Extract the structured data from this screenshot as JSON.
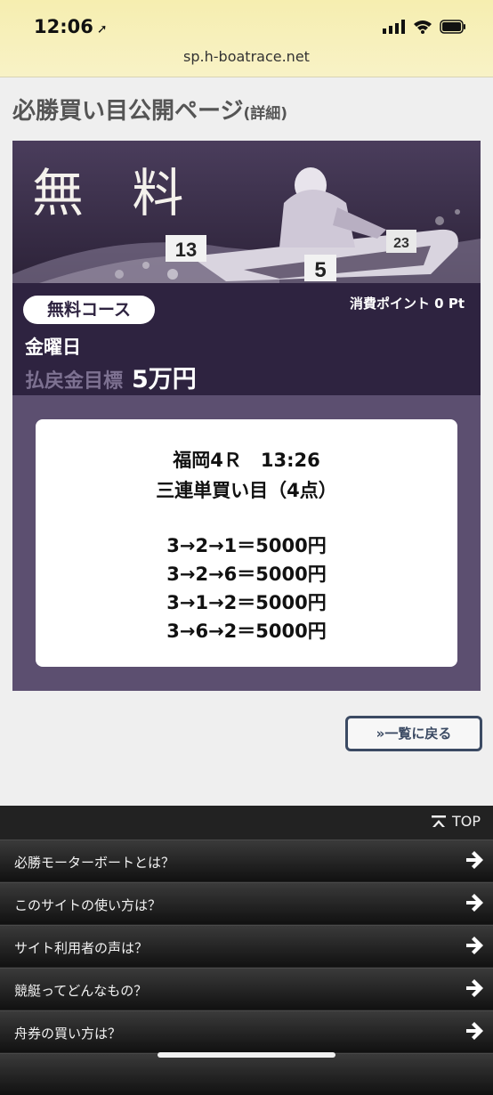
{
  "status_bar": {
    "time": "12:06"
  },
  "browser": {
    "url": "sp.h-boatrace.net"
  },
  "page": {
    "title": "必勝買い目公開ページ",
    "title_suffix": "(詳細)"
  },
  "course": {
    "banner_text": "無 料",
    "boat_numbers": [
      "13",
      "5",
      "23"
    ],
    "name": "無料コース",
    "points": "消費ポイント 0 Pt",
    "day": "金曜日",
    "target_label": "払戻金目標",
    "target_value": "5万円"
  },
  "tips": {
    "race": "福岡4Ｒ　13:26",
    "bet_type": "三連単買い目（4点）",
    "picks": [
      "3→2→1＝5000円",
      "3→2→6＝5000円",
      "3→1→2＝5000円",
      "3→6→2＝5000円"
    ]
  },
  "back_button": {
    "label": "»一覧に戻る"
  },
  "footer": {
    "top_label": "TOP",
    "menu": [
      {
        "label": "必勝モーターボートとは？"
      },
      {
        "label": "このサイトの使い方は？"
      },
      {
        "label": "サイト利用者の声は？"
      },
      {
        "label": "競艇ってどんなもの？"
      },
      {
        "label": "舟券の買い方は？"
      }
    ]
  },
  "colors": {
    "card": "#5c4f70",
    "band": "#2e2340",
    "topbar": "#f6eeb0",
    "footer": "#222222"
  }
}
